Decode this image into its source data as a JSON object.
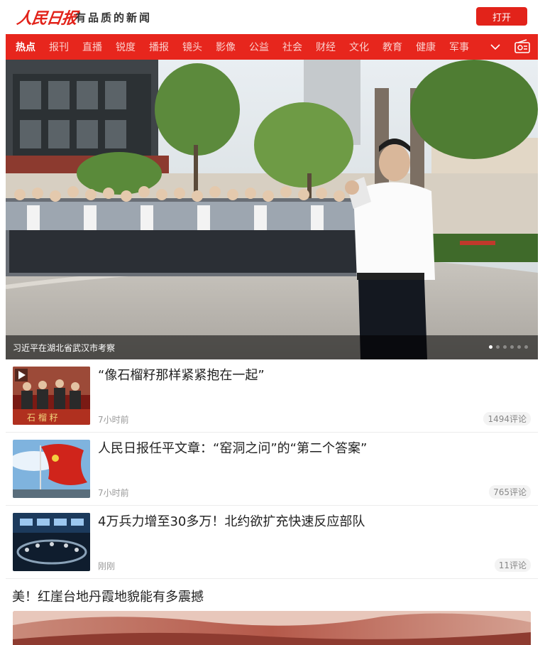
{
  "header": {
    "logo_text": "人民日报",
    "slogan": "有品质的新闻",
    "open_button": "打开"
  },
  "nav": {
    "items": [
      "热点",
      "报刊",
      "直播",
      "锐度",
      "播报",
      "镜头",
      "影像",
      "公益",
      "社会",
      "财经",
      "文化",
      "教育",
      "健康",
      "军事"
    ],
    "active_index": 0
  },
  "hero": {
    "caption": "习近平在湖北省武汉市考察",
    "slide_count": 6,
    "active_slide": 1
  },
  "articles": [
    {
      "title": "“像石榴籽那样紧紧抱在一起”",
      "time": "7小时前",
      "comments": "1494评论",
      "is_video": true
    },
    {
      "title": "人民日报任平文章：“窑洞之问”的“第二个答案”",
      "time": "7小时前",
      "comments": "765评论",
      "is_video": false
    },
    {
      "title": "4万兵力增至30多万！北约欲扩充快速反应部队",
      "time": "刚刚",
      "comments": "11评论",
      "is_video": false
    }
  ],
  "featured": {
    "title": "美！红崖台地丹霞地貌能有多震撼"
  },
  "colors": {
    "brand_red": "#e2231a",
    "nav_bg": "#e7261d"
  }
}
